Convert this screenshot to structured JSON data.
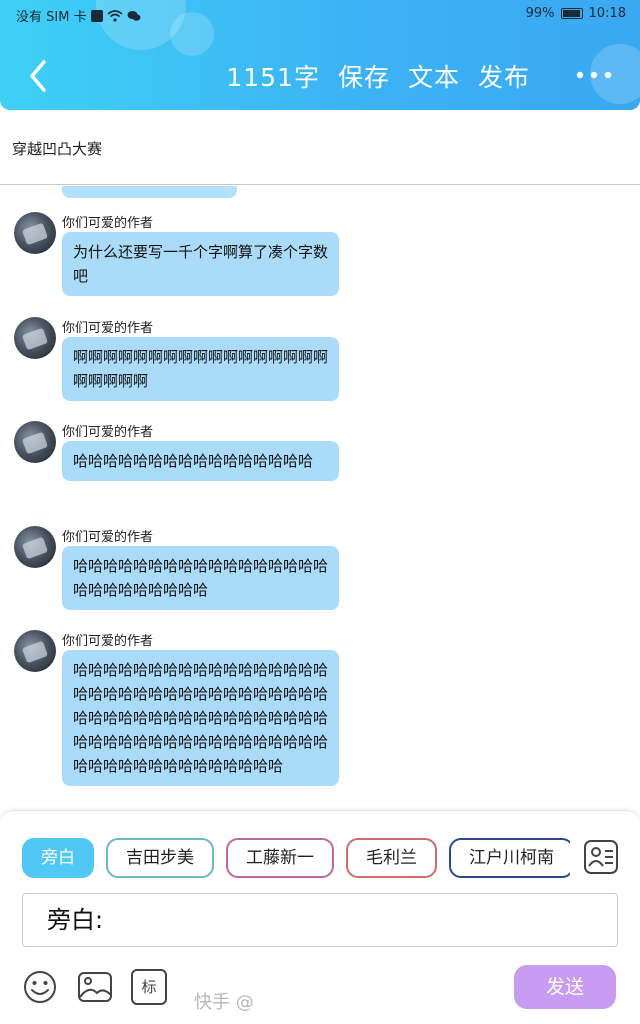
{
  "status_bar": {
    "carrier": "没有 SIM 卡",
    "battery": "99%",
    "time": "10:18"
  },
  "toolbar": {
    "word_count": "1151字",
    "save": "保存",
    "text": "文本",
    "publish": "发布"
  },
  "title": "穿越凹凸大赛",
  "messages": [
    {
      "author": "你们可爱的作者",
      "text": "为什么还要写一千个字啊算了凑个字数吧"
    },
    {
      "author": "你们可爱的作者",
      "text": "啊啊啊啊啊啊啊啊啊啊啊啊啊啊啊啊啊啊啊啊啊啊"
    },
    {
      "author": "你们可爱的作者",
      "text": "哈哈哈哈哈哈哈哈哈哈哈哈哈哈哈哈"
    },
    {
      "author": "你们可爱的作者",
      "text": "哈哈哈哈哈哈哈哈哈哈哈哈哈哈哈哈哈哈哈哈哈哈哈哈哈哈"
    },
    {
      "author": "你们可爱的作者",
      "text": "哈哈哈哈哈哈哈哈哈哈哈哈哈哈哈哈哈哈哈哈哈哈哈哈哈哈哈哈哈哈哈哈哈哈哈哈哈哈哈哈哈哈哈哈哈哈哈哈哈哈哈哈哈哈哈哈哈哈哈哈哈哈哈哈哈哈哈哈哈哈哈哈哈哈哈哈哈哈哈哈哈哈"
    }
  ],
  "characters": [
    {
      "label": "旁白",
      "color": "#51c7f6"
    },
    {
      "label": "吉田步美",
      "color": "#6bb9c4"
    },
    {
      "label": "工藤新一",
      "color": "#c0689e"
    },
    {
      "label": "毛利兰",
      "color": "#cf6c6c"
    },
    {
      "label": "江户川柯南",
      "color": "#2a4a8c"
    }
  ],
  "input": {
    "value": "旁白:"
  },
  "send_label": "发送",
  "watermark": "快手 @",
  "icons": {
    "back": "back-arrow-icon",
    "more": "more-icon",
    "contact": "contact-card-icon",
    "emoji": "emoji-icon",
    "image": "image-icon",
    "mark": "标"
  }
}
